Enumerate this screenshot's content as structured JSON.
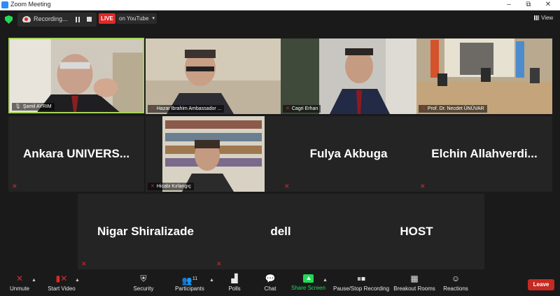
{
  "window": {
    "title": "Zoom Meeting",
    "minimize": "–",
    "maximize": "⧉",
    "close": "✕"
  },
  "recording": {
    "label": "Recording..."
  },
  "live": {
    "badge": "LIVE",
    "target": "on YouTube"
  },
  "view": {
    "label": "View"
  },
  "participants_count": "11",
  "tiles": [
    {
      "name": "Şamil AYRIM",
      "has_video": true,
      "muted": false,
      "active_speaker": true
    },
    {
      "name": "Hazar Ibrahim Ambassador ...",
      "has_video": true,
      "muted": true
    },
    {
      "name": "Cagri Erhan",
      "has_video": true,
      "muted": true
    },
    {
      "name": "Prof. Dr.  Necdet ÜNÜVAR",
      "has_video": true,
      "muted": true
    },
    {
      "display": "Ankara  UNIVERS...",
      "has_video": false,
      "muted": true
    },
    {
      "name": "Hicabi Kırlangıç",
      "has_video": true,
      "muted": true
    },
    {
      "display": "Fulya Akbuga",
      "has_video": false,
      "muted": true
    },
    {
      "display": "Elchin  Allahverdi...",
      "has_video": false,
      "muted": true
    },
    {
      "display": "Nigar Shiralizade",
      "has_video": false,
      "muted": true
    },
    {
      "display": "dell",
      "has_video": false,
      "muted": true
    },
    {
      "display": "HOST",
      "has_video": false,
      "muted": false
    }
  ],
  "toolbar": {
    "unmute": "Unmute",
    "start_video": "Start Video",
    "security": "Security",
    "participants": "Participants",
    "polls": "Polls",
    "chat": "Chat",
    "share_screen": "Share Screen",
    "pause_stop_recording": "Pause/Stop Recording",
    "breakout_rooms": "Breakout Rooms",
    "reactions": "Reactions",
    "leave": "Leave"
  },
  "colors": {
    "accent_green": "#23d959",
    "active_border": "#a8d35c",
    "live_red": "#e02828",
    "leave_red": "#c52a22",
    "tile_bg": "#242424",
    "page_bg": "#1a1a1a"
  }
}
